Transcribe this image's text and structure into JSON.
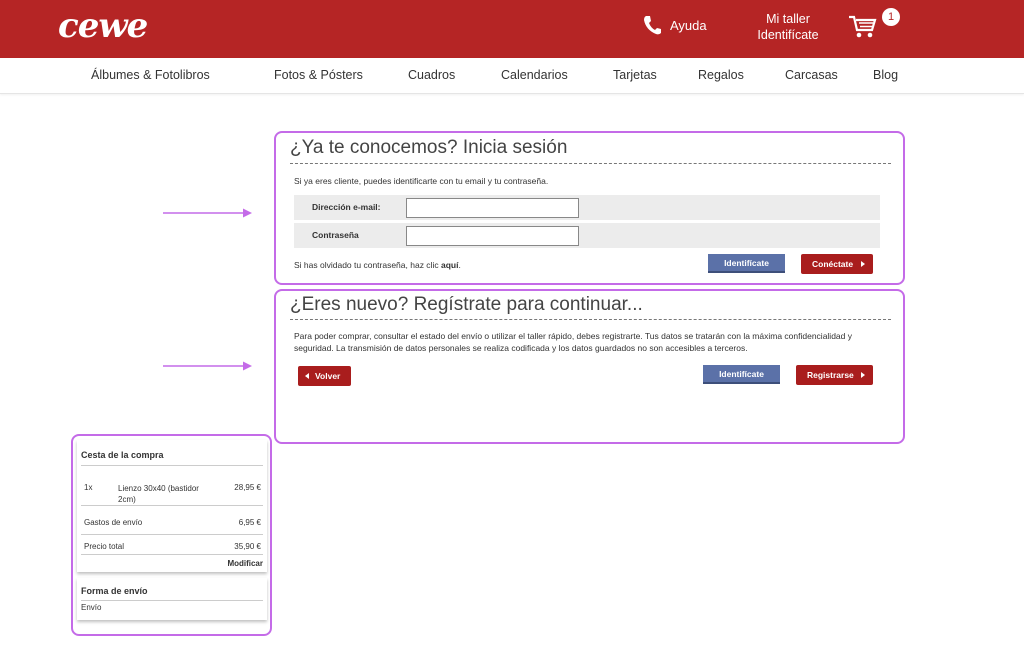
{
  "header": {
    "logo": "cewe",
    "help_label": "Ayuda",
    "mytaller_line1": "Mi taller",
    "mytaller_line2": "Identifícate",
    "cart_count": "1",
    "brand_color": "#b52525"
  },
  "nav": {
    "items": [
      "Álbumes & Fotolibros",
      "Fotos & Pósters",
      "Cuadros",
      "Calendarios",
      "Tarjetas",
      "Regalos",
      "Carcasas",
      "Blog"
    ]
  },
  "login": {
    "title": "¿Ya te conocemos? Inicia sesión",
    "intro": "Si ya eres cliente, puedes identificarte con tu email y tu contraseña.",
    "email_label": "Dirección e-mail:",
    "email_value": "",
    "password_label": "Contraseña",
    "password_value": "",
    "forgot_text": "Si has olvidado tu contraseña, haz clic",
    "forgot_link": "aquí",
    "forgot_end": ".",
    "identify_button": "Identifícate",
    "connect_button": "Conéctate"
  },
  "register": {
    "title": "¿Eres nuevo? Regístrate para continuar...",
    "text": "Para poder comprar, consultar el estado del envío o utilizar el taller rápido, debes registrarte. Tus datos se tratarán con la máxima confidencialidad y seguridad. La transmisión de datos personales se realiza codificada y los datos guardados no son accesibles a terceros.",
    "back_button": "Volver",
    "identify_button": "Identifícate",
    "register_button": "Registrarse"
  },
  "basket": {
    "title": "Cesta de la compra",
    "item_qty": "1x",
    "item_name": "Lienzo 30x40 (bastidor 2cm)",
    "item_price": "28,95 €",
    "shipping_label": "Gastos de envío",
    "shipping_price": "6,95 €",
    "total_label": "Precio total",
    "total_price": "35,90 €",
    "modify_link": "Modificar"
  },
  "shipping": {
    "title": "Forma de envío",
    "value": "Envío"
  },
  "colors": {
    "highlight": "#c46be8",
    "button_red": "#a91d1d",
    "button_blue": "#5b71a8"
  }
}
